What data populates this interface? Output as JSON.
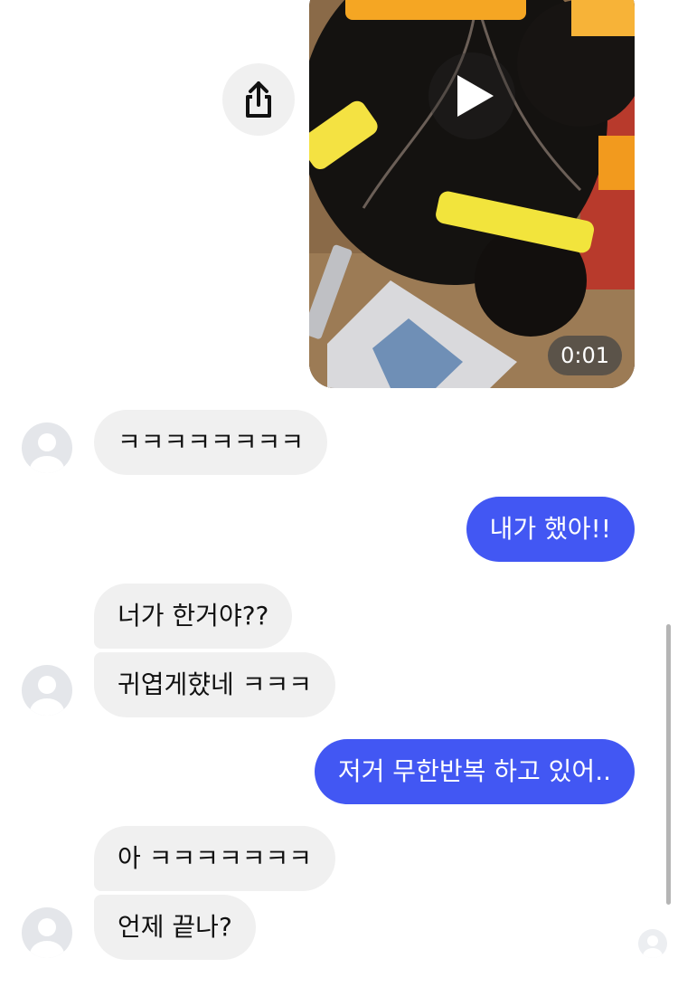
{
  "video_message": {
    "duration": "0:01",
    "icon": "play-icon"
  },
  "share": {
    "icon": "share-icon"
  },
  "messages": [
    {
      "direction": "incoming",
      "text": "ㅋㅋㅋㅋㅋㅋㅋㅋ"
    },
    {
      "direction": "outgoing",
      "text": "내가 했아!!"
    },
    {
      "direction": "incoming",
      "text": "너가 한거야??"
    },
    {
      "direction": "incoming",
      "text": "귀엽게햤네 ㅋㅋㅋ"
    },
    {
      "direction": "outgoing",
      "text": "저거 무한반복 하고 있어.."
    },
    {
      "direction": "incoming",
      "text": "아 ㅋㅋㅋㅋㅋㅋㅋ"
    },
    {
      "direction": "incoming",
      "text": "언제 끝나?"
    }
  ],
  "colors": {
    "outgoing_bubble": "#4257f3",
    "incoming_bubble": "#f0f0f0",
    "background": "#ffffff"
  }
}
